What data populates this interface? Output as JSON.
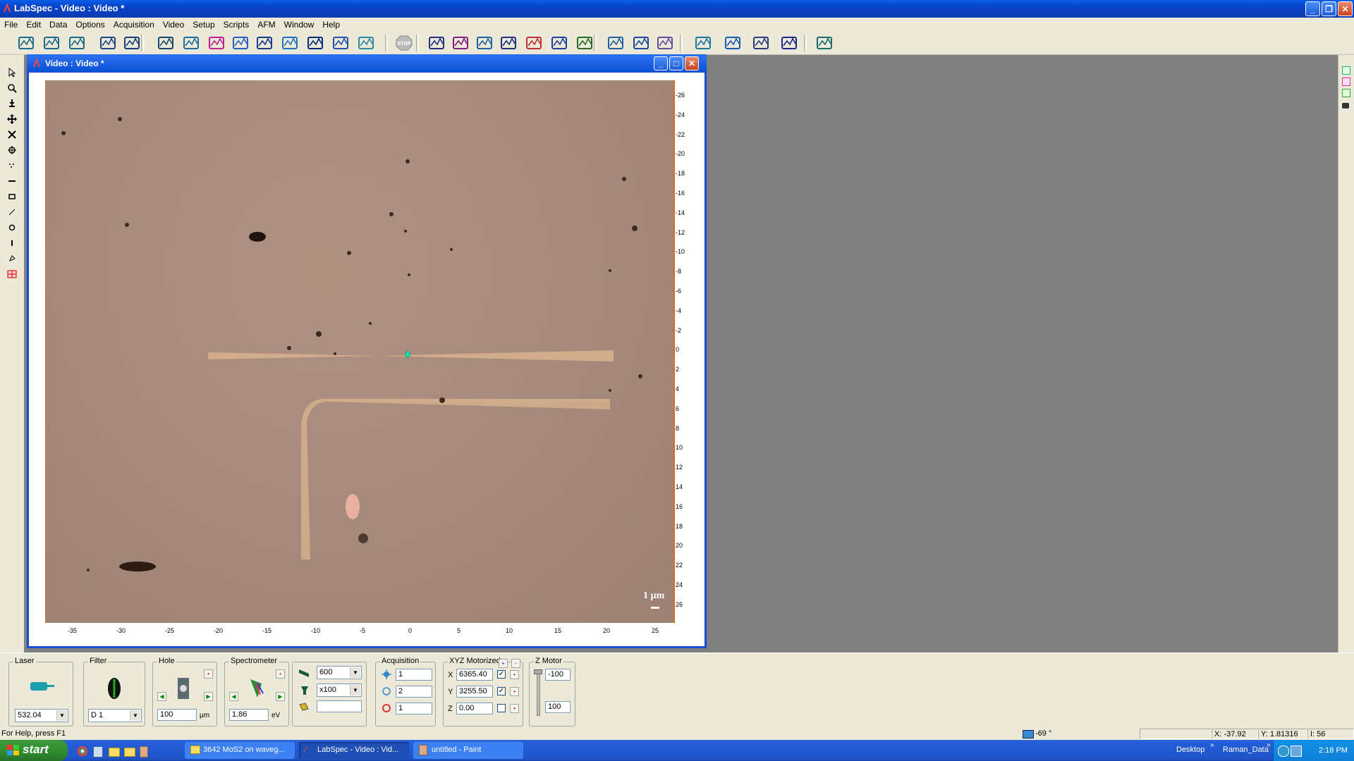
{
  "window": {
    "title": "LabSpec - Video : Video *"
  },
  "menu": [
    "File",
    "Edit",
    "Data",
    "Options",
    "Acquisition",
    "Video",
    "Setup",
    "Scripts",
    "AFM",
    "Window",
    "Help"
  ],
  "toolbar_icons": [
    "grid-move-icon",
    "vertical-arrows-icon",
    "horizontal-arrows-icon",
    "image-icon",
    "info-icon",
    "spectrum-icon",
    "map-icon",
    "fish-icon",
    "grid-icon",
    "table-icon",
    "chart-icon",
    "sphere-icon",
    "expand-icon",
    "triangle-icon",
    "stop-icon",
    "peaks-icon",
    "mountains-icon",
    "surface-icon",
    "fit-icon",
    "scatter-icon",
    "histogram-icon",
    "multi-icon",
    "convert-icon",
    "tools-icon",
    "graph-icon",
    "open-icon",
    "save-icon",
    "print-icon",
    "help-icon",
    "basket-icon"
  ],
  "video_window": {
    "title": "Video : Video *",
    "scale_bar": "1 µm",
    "x_ticks": [
      "-35",
      "-30",
      "-25",
      "-20",
      "-15",
      "-10",
      "-5",
      "0",
      "5",
      "10",
      "15",
      "20",
      "25"
    ],
    "y_ticks": [
      "-26",
      "-24",
      "-22",
      "-20",
      "-18",
      "-16",
      "-14",
      "-12",
      "-10",
      "-8",
      "-6",
      "-4",
      "-2",
      "0",
      "2",
      "4",
      "6",
      "8",
      "10",
      "12",
      "14",
      "16",
      "18",
      "20",
      "22",
      "24",
      "26"
    ]
  },
  "panel": {
    "laser": {
      "label": "Laser",
      "value": "532.04"
    },
    "filter": {
      "label": "Filter",
      "value": "D 1"
    },
    "hole": {
      "label": "Hole",
      "value": "100",
      "unit": "µm"
    },
    "spectrometer": {
      "label": "Spectrometer",
      "value": "1.86",
      "unit": "eV"
    },
    "grating": {
      "value": "600"
    },
    "objective": {
      "value": "x100"
    },
    "extra": {
      "value": ""
    },
    "acquisition": {
      "label": "Acquisition",
      "values": [
        "1",
        "2",
        "1"
      ]
    },
    "xyz": {
      "label": "XYZ Motorized",
      "x_label": "X",
      "x": "6365.40",
      "y_label": "Y",
      "y": "3255.50",
      "z_label": "Z",
      "z": "0.00",
      "x_checked": true,
      "y_checked": true,
      "z_checked": false
    },
    "zmotor": {
      "label": "Z Motor",
      "top": "-100",
      "bottom": "100"
    }
  },
  "status": {
    "help": "For Help, press F1",
    "angle": "-69 °",
    "x": "X: -37.92",
    "y": "Y: 1.81316",
    "i": "I: 56"
  },
  "taskbar": {
    "start": "start",
    "tasks": [
      "3642 MoS2 on waveg...",
      "LabSpec - Video : Vid...",
      "untitled - Paint"
    ],
    "tray_desktop": "Desktop",
    "tray_raman": "Raman_Data",
    "time": "2:18 PM"
  }
}
